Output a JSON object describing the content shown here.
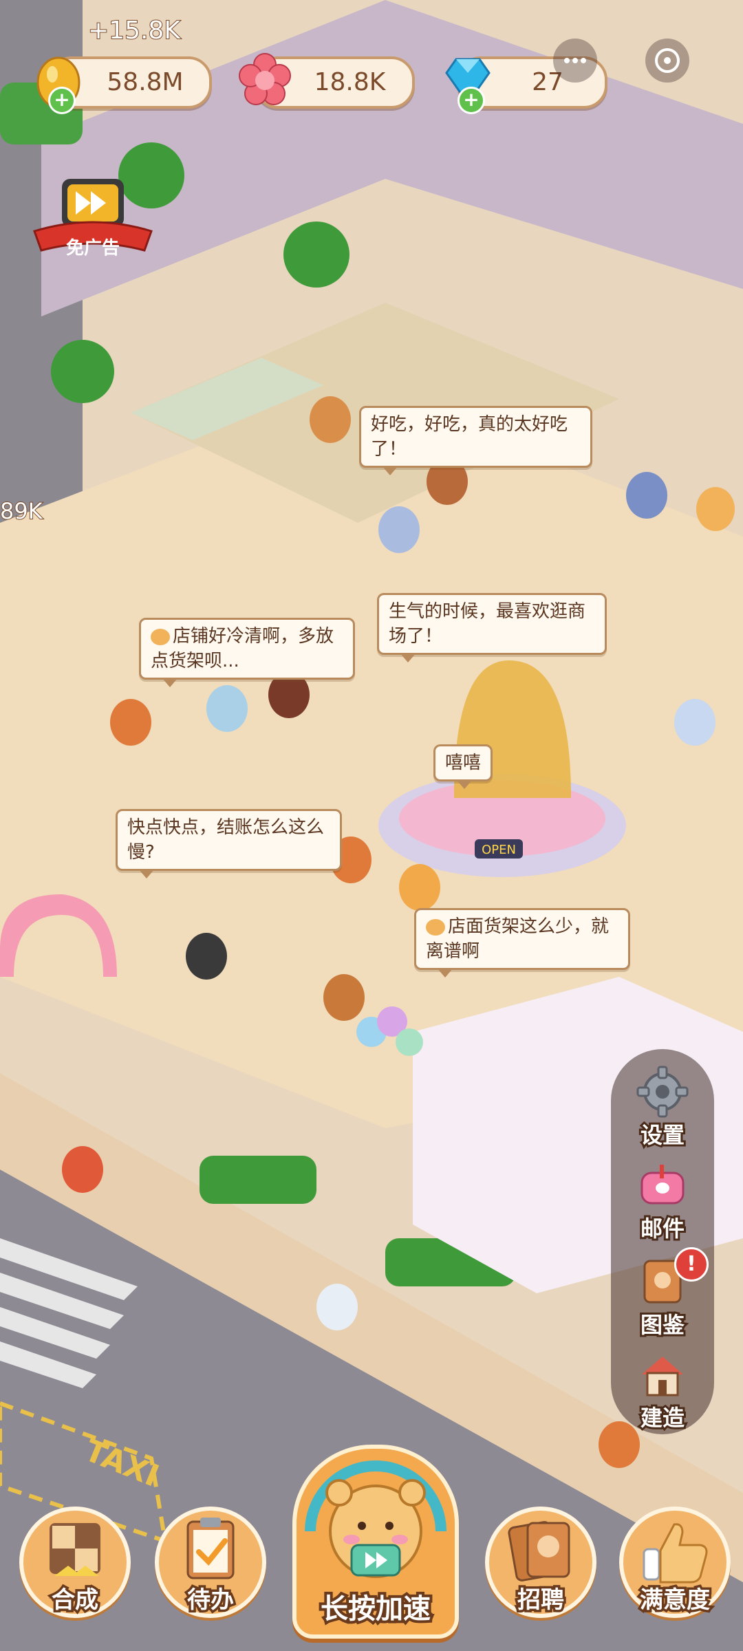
{
  "resources": {
    "gold": {
      "value": "58.8M",
      "icon": "golden-egg-icon"
    },
    "flower": {
      "value": "18.8K",
      "icon": "pink-flower-icon"
    },
    "diamond": {
      "value": "27",
      "icon": "blue-diamond-icon"
    }
  },
  "floating_gain": "+15.8K",
  "side_edge_value": "89K",
  "ad_button": {
    "label": "免广告"
  },
  "speech_bubbles": [
    {
      "text": "好吃，好吃，真的太好吃了！"
    },
    {
      "text": "生气的时候，最喜欢逛商场了！"
    },
    {
      "text": "店铺好冷清啊，多放点货架呗..."
    },
    {
      "text": "嘻嘻"
    },
    {
      "text": "快点快点，结账怎么这么慢?"
    },
    {
      "text": "店面货架这么少，就离谱啊"
    }
  ],
  "side_menu": {
    "settings": "设置",
    "mail": "邮件",
    "catalog": "图鉴",
    "catalog_badge": "!",
    "build": "建造"
  },
  "bottom_bar": {
    "merge": "合成",
    "todo": "待办",
    "speed_up": "长按加速",
    "recruit": "招聘",
    "satisfaction": "满意度"
  },
  "shop_sign": "OPEN",
  "taxi_text": "TAXI",
  "colors": {
    "accent": "#f4a94f",
    "text_brown": "#7a4a2a",
    "plus_green": "#5fc04b",
    "alert_red": "#e0403a"
  }
}
